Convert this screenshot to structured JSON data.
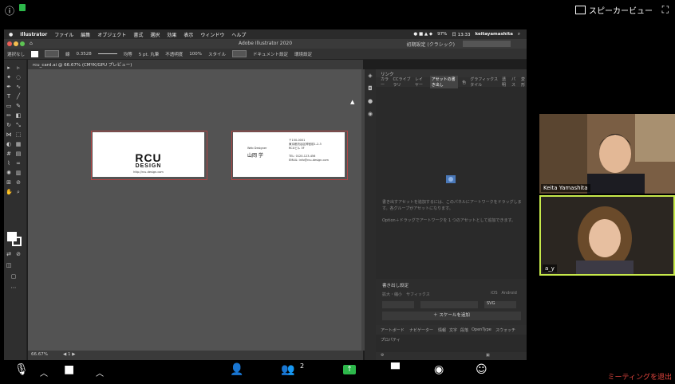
{
  "zoom_top": {
    "left_icons": [
      "info-icon",
      "lock-icon"
    ],
    "speaker_view_label": "スピーカービュー"
  },
  "mac_menubar": {
    "app_name": "Illustrator",
    "menus": [
      "ファイル",
      "編集",
      "オブジェクト",
      "書式",
      "選択",
      "効果",
      "表示",
      "ウィンドウ",
      "ヘルプ"
    ],
    "battery": "97%",
    "time": "日 13:33",
    "user": "keitayamashita"
  },
  "ai_titlebar": {
    "title": "Adobe Illustrator 2020",
    "workspace": "初期設定 (クラシック)"
  },
  "control_bar": {
    "selection_label": "選択なし",
    "stroke_label": "線",
    "stroke_value": "0.3528",
    "brush_label": "均等",
    "point_label": "5 pt. 丸筆",
    "opacity_label": "不透明度",
    "opacity_value": "100%",
    "style_label": "スタイル",
    "doc_setup": "ドキュメント設定",
    "prefs": "環境設定"
  },
  "document": {
    "tab_label": "rcu_card.ai @ 66.67% (CMYK/GPU プレビュー)",
    "zoom_status": "66.67%"
  },
  "card_front": {
    "logo_line1": "RCU",
    "logo_line2": "DESIGN",
    "url": "http://rcu-design.com"
  },
  "card_back": {
    "role": "Web Designer",
    "name": "山岡 学",
    "address1": "〒150-0001",
    "address2": "東京都渋谷区神宮前1-2-3",
    "address3": "RCUビル 3F",
    "tel": "TEL: 0120-123-456",
    "email": "EMAIL: info@rcu-design.com"
  },
  "right_panel": {
    "header": "リンク",
    "tabs": [
      "カラー",
      "CCライブラリ",
      "レイヤー",
      "アセットの書き出し",
      "色",
      "グラフィックスタイル",
      "透明",
      "パス",
      "変形"
    ],
    "active_tab": "アセットの書き出し",
    "desc": "書き出すアセットを追加するには、このパネルにアートワークをドラッグします。各グループがアセットになります。",
    "desc2": "Option＋ドラッグでアートワークを 1 つのアセットとして追加できます。",
    "export_settings_title": "書き出し設定",
    "export_row_label": "拡大・縮小　サフィックス",
    "size_label": "iOS　Android",
    "format": "SVG",
    "add_scale_label": "＋ スケールを追加",
    "bottom_tabs": [
      "アートボード",
      "ナビゲーター",
      "情報",
      "文字",
      "段落",
      "OpenType",
      "スウォッチ"
    ],
    "properties_label": "プロパティ"
  },
  "participants": [
    {
      "name": "Keita Yamashita"
    },
    {
      "name": "a_y"
    }
  ],
  "zoom_bottom": {
    "participant_count": "2",
    "end_meeting_label": "ミーティングを退出"
  },
  "colors": {
    "zoom_bg": "#000000",
    "accent_green": "#2db84b",
    "active_speaker_border": "#c7e94b",
    "end_meeting": "#e0453e",
    "artboard_selection": "#b04545"
  }
}
